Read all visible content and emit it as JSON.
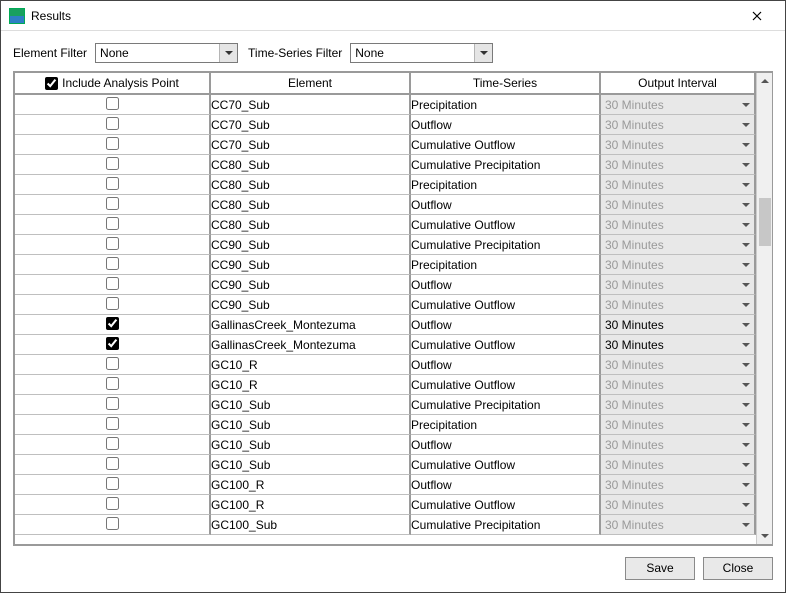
{
  "window": {
    "title": "Results"
  },
  "filters": {
    "element_label": "Element Filter",
    "element_value": "None",
    "timeseries_label": "Time-Series Filter",
    "timeseries_value": "None"
  },
  "columns": {
    "include": "Include Analysis Point",
    "element": "Element",
    "timeseries": "Time-Series",
    "interval": "Output Interval"
  },
  "header_include_checked": true,
  "rows": [
    {
      "include": false,
      "element": "CC70_Sub",
      "timeseries": "Precipitation",
      "interval": "30 Minutes",
      "interval_enabled": false
    },
    {
      "include": false,
      "element": "CC70_Sub",
      "timeseries": "Outflow",
      "interval": "30 Minutes",
      "interval_enabled": false
    },
    {
      "include": false,
      "element": "CC70_Sub",
      "timeseries": "Cumulative Outflow",
      "interval": "30 Minutes",
      "interval_enabled": false
    },
    {
      "include": false,
      "element": "CC80_Sub",
      "timeseries": "Cumulative Precipitation",
      "interval": "30 Minutes",
      "interval_enabled": false
    },
    {
      "include": false,
      "element": "CC80_Sub",
      "timeseries": "Precipitation",
      "interval": "30 Minutes",
      "interval_enabled": false
    },
    {
      "include": false,
      "element": "CC80_Sub",
      "timeseries": "Outflow",
      "interval": "30 Minutes",
      "interval_enabled": false
    },
    {
      "include": false,
      "element": "CC80_Sub",
      "timeseries": "Cumulative Outflow",
      "interval": "30 Minutes",
      "interval_enabled": false
    },
    {
      "include": false,
      "element": "CC90_Sub",
      "timeseries": "Cumulative Precipitation",
      "interval": "30 Minutes",
      "interval_enabled": false
    },
    {
      "include": false,
      "element": "CC90_Sub",
      "timeseries": "Precipitation",
      "interval": "30 Minutes",
      "interval_enabled": false
    },
    {
      "include": false,
      "element": "CC90_Sub",
      "timeseries": "Outflow",
      "interval": "30 Minutes",
      "interval_enabled": false
    },
    {
      "include": false,
      "element": "CC90_Sub",
      "timeseries": "Cumulative Outflow",
      "interval": "30 Minutes",
      "interval_enabled": false
    },
    {
      "include": true,
      "element": "GallinasCreek_Montezuma",
      "timeseries": "Outflow",
      "interval": "30 Minutes",
      "interval_enabled": true
    },
    {
      "include": true,
      "element": "GallinasCreek_Montezuma",
      "timeseries": "Cumulative Outflow",
      "interval": "30 Minutes",
      "interval_enabled": true
    },
    {
      "include": false,
      "element": "GC10_R",
      "timeseries": "Outflow",
      "interval": "30 Minutes",
      "interval_enabled": false
    },
    {
      "include": false,
      "element": "GC10_R",
      "timeseries": "Cumulative Outflow",
      "interval": "30 Minutes",
      "interval_enabled": false
    },
    {
      "include": false,
      "element": "GC10_Sub",
      "timeseries": "Cumulative Precipitation",
      "interval": "30 Minutes",
      "interval_enabled": false
    },
    {
      "include": false,
      "element": "GC10_Sub",
      "timeseries": "Precipitation",
      "interval": "30 Minutes",
      "interval_enabled": false
    },
    {
      "include": false,
      "element": "GC10_Sub",
      "timeseries": "Outflow",
      "interval": "30 Minutes",
      "interval_enabled": false
    },
    {
      "include": false,
      "element": "GC10_Sub",
      "timeseries": "Cumulative Outflow",
      "interval": "30 Minutes",
      "interval_enabled": false
    },
    {
      "include": false,
      "element": "GC100_R",
      "timeseries": "Outflow",
      "interval": "30 Minutes",
      "interval_enabled": false
    },
    {
      "include": false,
      "element": "GC100_R",
      "timeseries": "Cumulative Outflow",
      "interval": "30 Minutes",
      "interval_enabled": false
    },
    {
      "include": false,
      "element": "GC100_Sub",
      "timeseries": "Cumulative Precipitation",
      "interval": "30 Minutes",
      "interval_enabled": false
    }
  ],
  "buttons": {
    "save": "Save",
    "close": "Close"
  }
}
